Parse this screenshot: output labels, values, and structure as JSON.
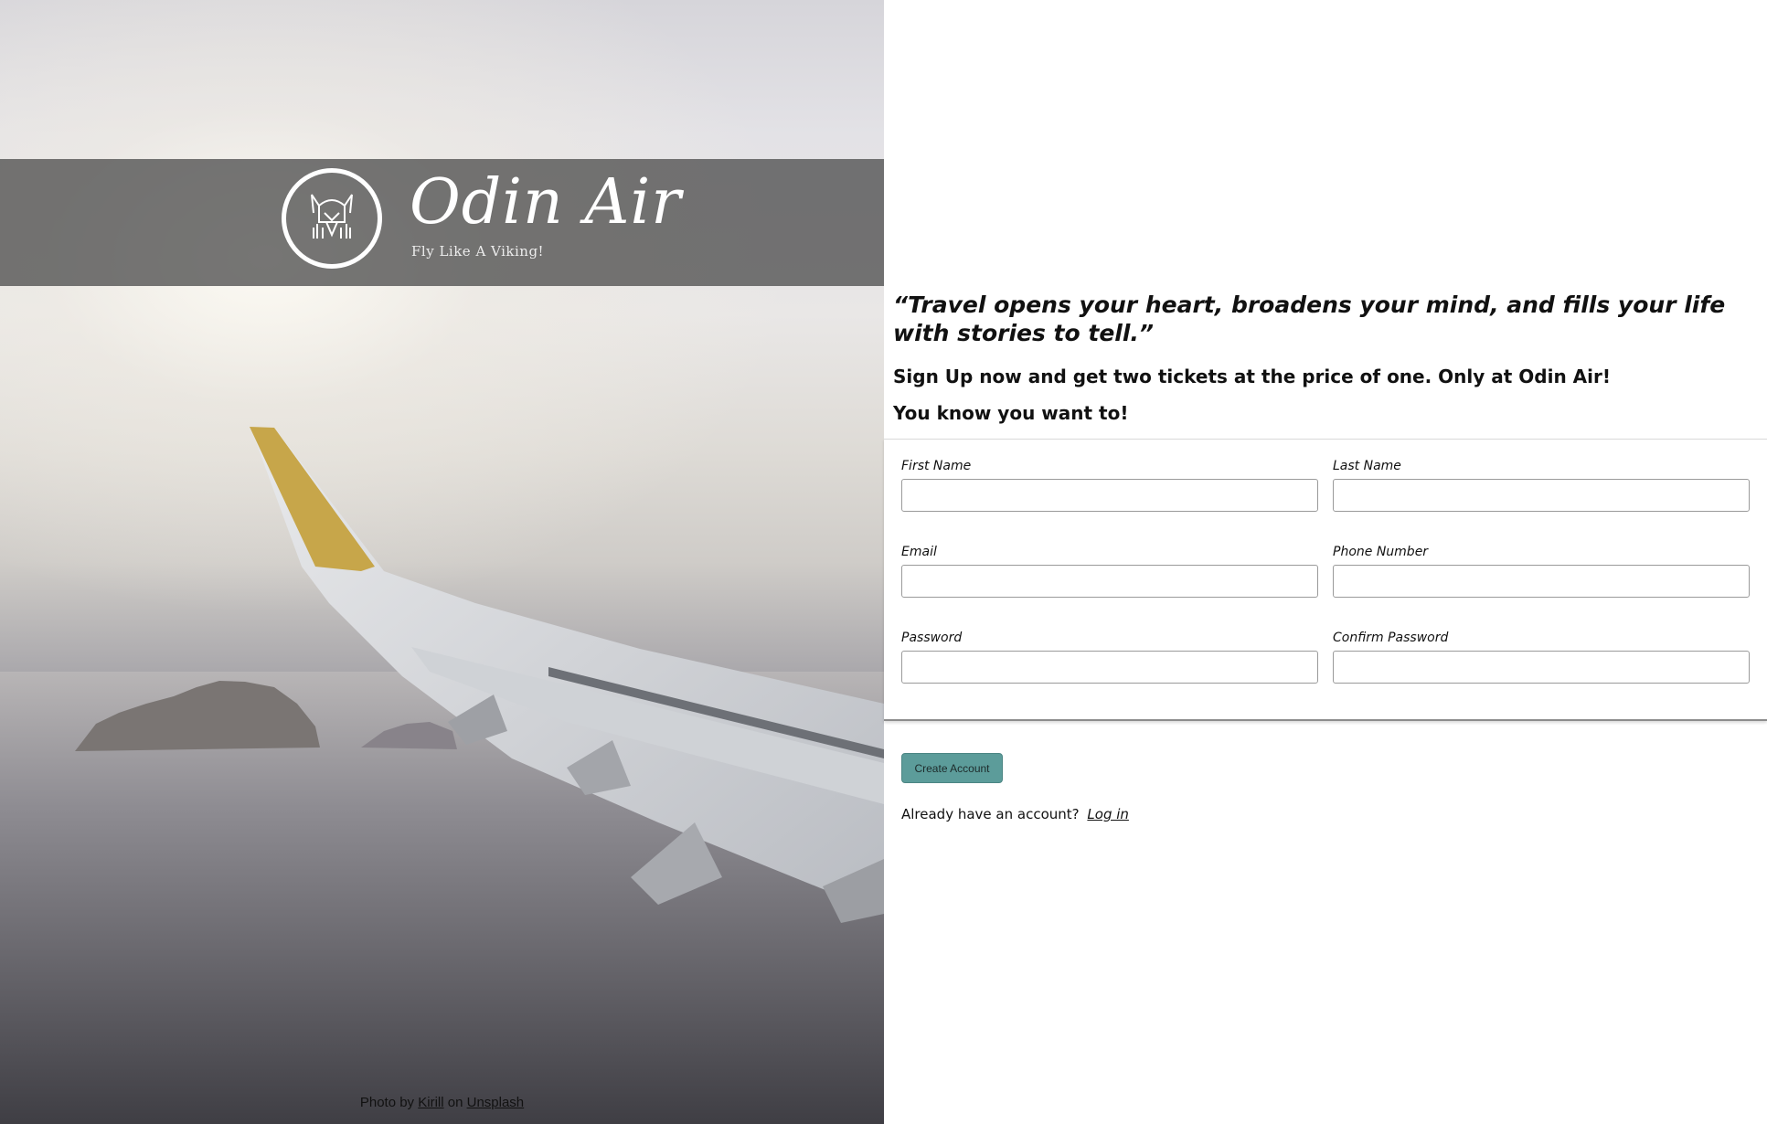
{
  "brand": {
    "name": "Odin Air",
    "tagline": "Fly Like A Viking!"
  },
  "credit": {
    "prefix": "Photo by",
    "author": "Kirill",
    "middle": "on",
    "site": "Unsplash"
  },
  "signup": {
    "quote": "“Travel opens your heart, broadens your mind, and fills your life with stories to tell.”",
    "promo_line1": "Sign Up now and get two tickets at the price of one. Only at Odin Air!",
    "promo_line2": "You know you want to!",
    "fields": {
      "first_name": {
        "label": "First Name",
        "value": ""
      },
      "last_name": {
        "label": "Last Name",
        "value": ""
      },
      "email": {
        "label": "Email",
        "value": ""
      },
      "phone": {
        "label": "Phone Number",
        "value": ""
      },
      "password": {
        "label": "Password",
        "value": ""
      },
      "confirm_password": {
        "label": "Confirm Password",
        "value": ""
      }
    },
    "submit_label": "Create Account",
    "login_prompt": "Already have an account?",
    "login_link": "Log in"
  },
  "colors": {
    "button_bg": "#5c9c9a",
    "brand_band": "#505050"
  },
  "icons": {
    "logo": "viking-helmet-logo-icon"
  }
}
